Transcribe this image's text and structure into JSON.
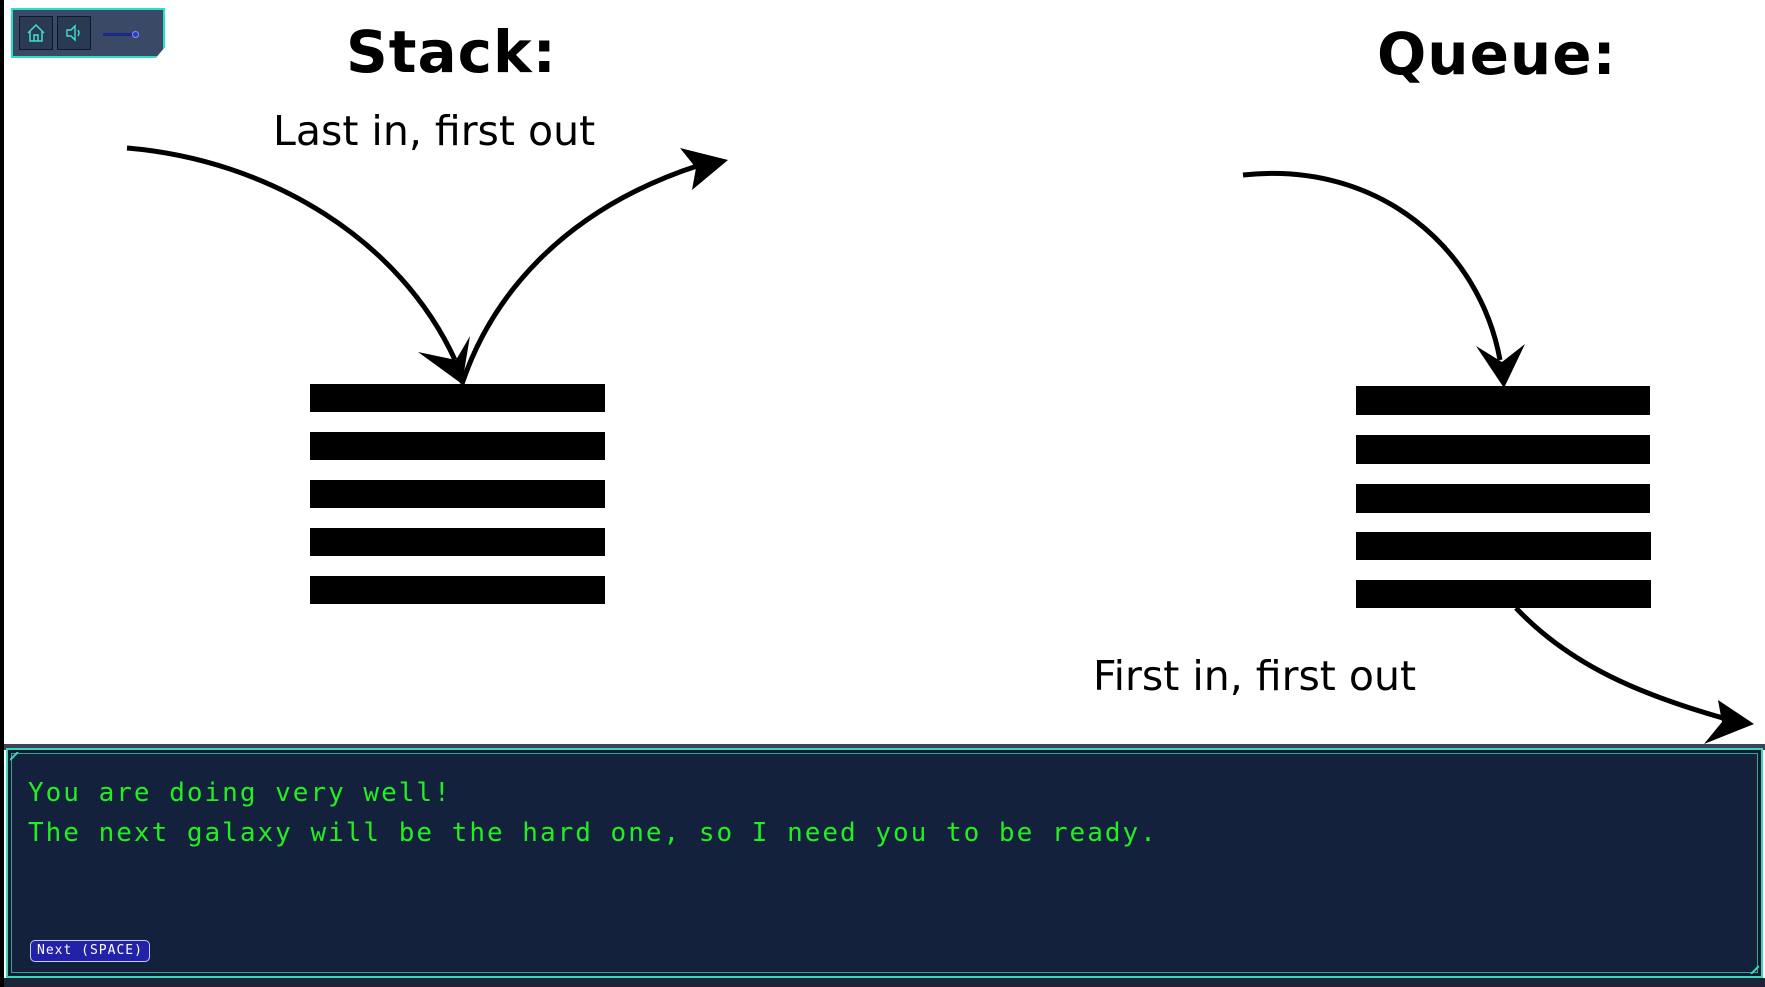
{
  "controls": {
    "home_icon": "home-icon",
    "sound_icon": "speaker-icon",
    "volume": 0.7,
    "accent_color": "#27e0c8"
  },
  "diagram": {
    "stack": {
      "title": "Stack:",
      "caption": "Last in, first out",
      "bar_count": 5
    },
    "queue": {
      "title": "Queue:",
      "caption": "First in, first out",
      "bar_count": 5
    }
  },
  "dialog": {
    "lines": [
      "You are doing very well!",
      "The next galaxy will be the hard one, so I need you to be ready."
    ],
    "next_label": "Next (SPACE)",
    "text_color": "#22ee22",
    "background": "#14213d",
    "border_color": "#3ad6c0"
  }
}
